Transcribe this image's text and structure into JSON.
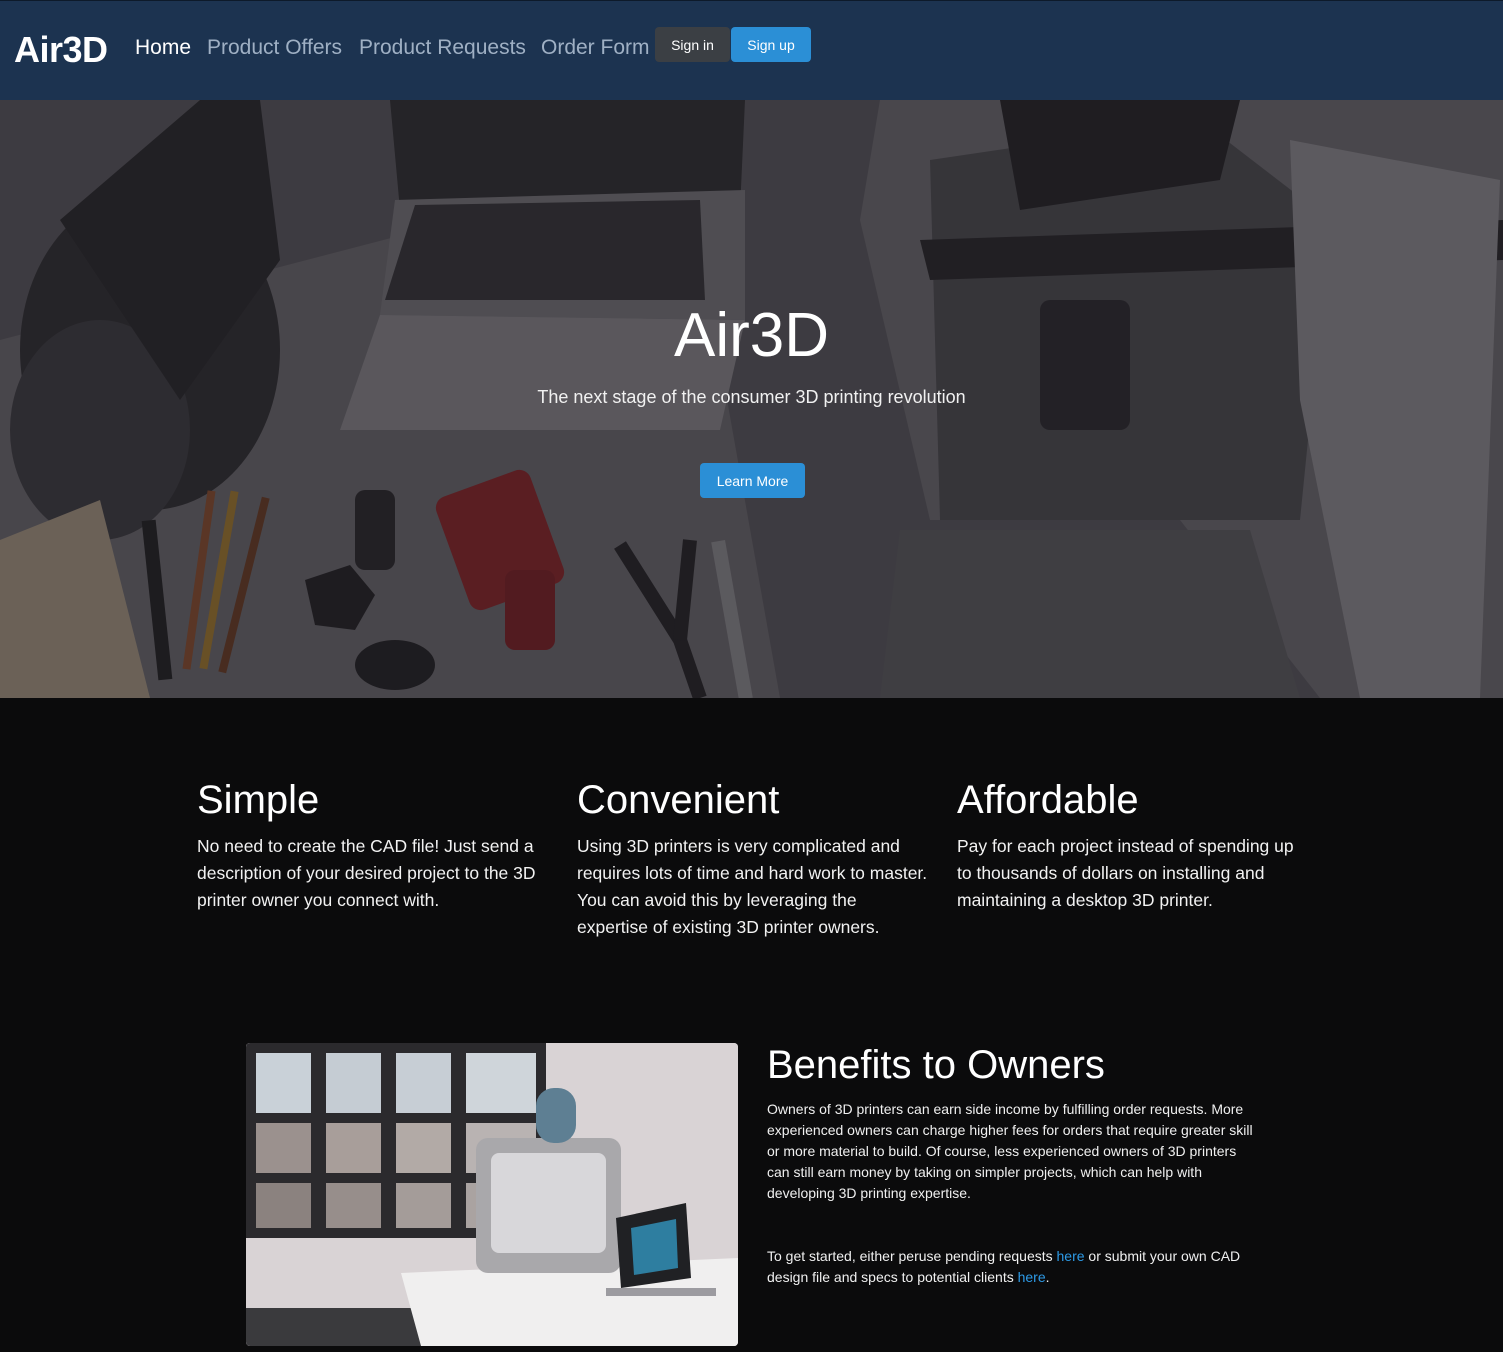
{
  "nav": {
    "brand": "Air3D",
    "links": [
      "Home",
      "Product Offers",
      "Product Requests",
      "Order Form"
    ],
    "signin": "Sign in",
    "signup": "Sign up"
  },
  "hero": {
    "title": "Air3D",
    "subtitle": "The next stage of the consumer 3D printing revolution",
    "cta": "Learn More"
  },
  "features": [
    {
      "title": "Simple",
      "text": "No need to create the CAD file! Just send a description of your desired project to the 3D printer owner you connect with."
    },
    {
      "title": "Convenient",
      "text": "Using 3D printers is very complicated and requires lots of time and hard work to master. You can avoid this by leveraging the expertise of existing 3D printer owners."
    },
    {
      "title": "Affordable",
      "text": "Pay for each project instead of spending up to thousands of dollars on installing and maintaining a desktop 3D printer."
    }
  ],
  "benefits": {
    "title": "Benefits to Owners",
    "paragraph": "Owners of 3D printers can earn side income by fulfilling order requests. More experienced owners can charge higher fees for orders that require greater skill or more material to build. Of course, less experienced owners of 3D printers can still earn money by taking on simpler projects, which can help with developing 3D printing expertise.",
    "cta_part1": "To get started, either peruse pending requests ",
    "link1": "here",
    "cta_part2": " or submit your own CAD design file and specs to potential clients ",
    "link2": "here",
    "cta_end": "."
  },
  "colors": {
    "navbar": "#1c3350",
    "primary": "#2b8fd6",
    "signin_bg": "#3b3f44",
    "body_bg": "#0b0b0c",
    "link": "#2d9ae6"
  }
}
